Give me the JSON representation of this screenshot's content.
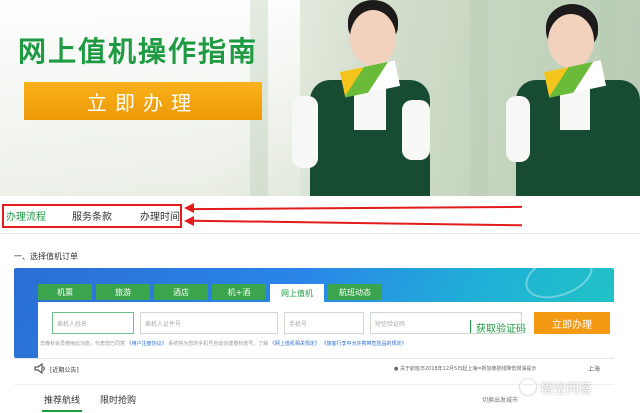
{
  "hero": {
    "title": "网上值机操作指南",
    "cta": "立即办理"
  },
  "tabs": [
    {
      "label": "办理流程",
      "active": true
    },
    {
      "label": "服务条款",
      "active": false
    },
    {
      "label": "办理时间",
      "active": false
    }
  ],
  "section": {
    "title": "一、选择值机订单"
  },
  "booking": {
    "tabs": [
      "机票",
      "旅游",
      "酒店",
      "机+酒",
      "网上值机",
      "航班动态"
    ],
    "active_tab": "网上值机",
    "fields": {
      "name_placeholder": "乘机人姓名",
      "id_placeholder": "乘机人证件号",
      "phone_placeholder": "手机号",
      "code_placeholder": "短信验证码"
    },
    "get_code": "获取验证码",
    "submit": "立即办理",
    "tips_1": "非春秋会员使用此功能，代表您已同意",
    "tips_link_1": "《用户注册协议》",
    "tips_2": "系统将为您的手机号自动创建春秋账号。了解",
    "tips_link_2": "《网上值机相关规定》",
    "tips_link_3": "《旅客行李中允许携带危险品的规定》"
  },
  "notice": {
    "label": "[近期公告]",
    "text": "● 关于航班日2018年12月5日起上海=新加坡航线降低燃油提示",
    "more": "上海"
  },
  "bottom_tabs": [
    {
      "label": "推荐航线",
      "active": true
    },
    {
      "label": "限时抢购",
      "active": false
    }
  ],
  "bottom_right": "切换出发城市",
  "watermark": "悟空问答",
  "colors": {
    "brand_green": "#1e9a43",
    "orange": "#f39a12",
    "annotation_red": "#e21b1b"
  }
}
